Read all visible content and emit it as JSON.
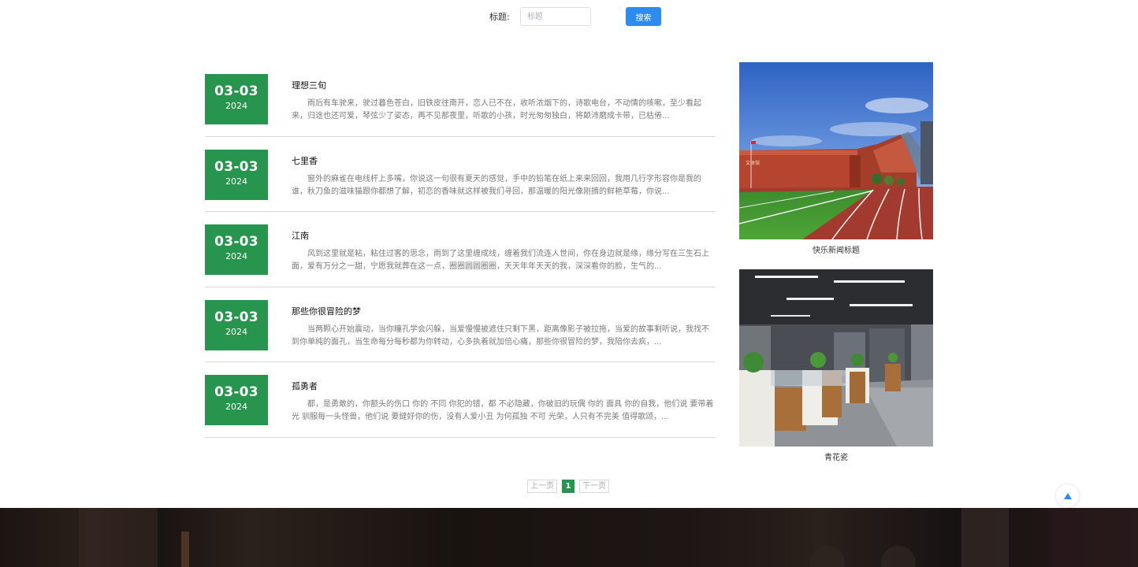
{
  "search": {
    "label": "标题:",
    "placeholder": "标题",
    "button": "搜索"
  },
  "news": [
    {
      "md": "03-03",
      "year": "2024",
      "title": "理想三旬",
      "summary": "雨后有车驶来，驶过暮色苍白，旧铁皮往南开，恋人已不在，收听浓烟下的，诗歌电台，不动情的咳嗽，至少看起来，归途也还可爱，琴弦少了姿态，再不见那夜里，听歌的小孩，时光匆匆独白，将颠沛磨成卡带，已枯倦..."
    },
    {
      "md": "03-03",
      "year": "2024",
      "title": "七里香",
      "summary": "窗外的麻雀在电线杆上多嘴，你说这一句很有夏天的感觉，手中的铅笔在纸上来来回回，我用几行字形容你是我的谁，秋刀鱼的滋味猫跟你都想了解，初恋的香味就这样被我们寻回，那温暖的阳光像刚摘的鲜艳草莓，你说..."
    },
    {
      "md": "03-03",
      "year": "2024",
      "title": "江南",
      "summary": "风到这里就是粘，粘住过客的思念，雨到了这里缠成线，缠着我们流连人世间，你在身边就是缘，缘分写在三生石上面，爱有万分之一甜，宁愿我就葬在这一点，圈圈圆圆圈圈，天天年年天天的我，深深看你的脸，生气的..."
    },
    {
      "md": "03-03",
      "year": "2024",
      "title": "那些你很冒险的梦",
      "summary": "当两颗心开始震动，当你瞳孔学会闪躲，当爱慢慢被遮住只剩下黑，距离像影子被拉拖，当爱的故事剩听说，我找不到你单纯的面孔，当生命每分每秒都为你转动，心多执着就加倍心痛，那些你很冒险的梦，我陪你去疯，..."
    },
    {
      "md": "03-03",
      "year": "2024",
      "title": "孤勇者",
      "summary": "都，是勇敢的，你额头的伤口 你的 不同 你犯的错，都 不必隐藏，你破旧的玩偶 你的 面具 你的自我，他们说 要带着光 驯服每一头怪兽，他们说 要缝好你的伤，没有人爱小丑 为何孤独 不可 光荣，人只有不完美 值得歌颂，..."
    }
  ],
  "side": [
    {
      "caption": "快乐新闻标题",
      "sign": "文体馆"
    },
    {
      "caption": "青花瓷"
    }
  ],
  "pagination": {
    "prev": "上一页",
    "current": "1",
    "next": "下一页"
  },
  "colors": {
    "accent_green": "#27954e",
    "search_blue": "#2d8cf0"
  },
  "icons": {
    "back_to_top": "triangle-up-icon"
  }
}
